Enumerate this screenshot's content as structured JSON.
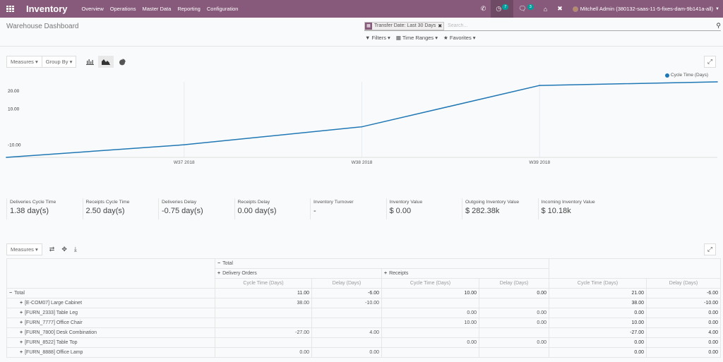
{
  "navbar": {
    "app_name": "Inventory",
    "menu": [
      "Overview",
      "Operations",
      "Master Data",
      "Reporting",
      "Configuration"
    ],
    "activity_count": "7",
    "message_count": "3",
    "user": "Mitchell Admin (380132-saas-11-5-fixes-dam-9b141a-all)",
    "accent": "#875a7b"
  },
  "control_panel": {
    "title": "Warehouse Dashboard",
    "facet": "Transfer Date: Last 30 Days",
    "search_placeholder": "Search...",
    "filters": "Filters",
    "time_ranges": "Time Ranges",
    "favorites": "Favorites"
  },
  "graph_toolbar": {
    "measures": "Measures",
    "group_by": "Group By"
  },
  "chart_data": {
    "type": "line",
    "x": [
      "",
      "W37 2018",
      "W38 2018",
      "W39 2018",
      ""
    ],
    "xticks": [
      "W37 2018",
      "W38 2018",
      "W39 2018"
    ],
    "series": [
      {
        "name": "Cycle Time (Days)",
        "values": [
          -17,
          -10,
          0,
          23,
          25
        ],
        "color": "#1f77b4"
      }
    ],
    "yticks": [
      "20.00",
      "10.00",
      "-10.00"
    ],
    "ytick_values": [
      20,
      10,
      -10
    ],
    "ylim": [
      -17,
      25
    ],
    "legend": "top-right",
    "grid": true
  },
  "kpis": [
    {
      "label": "Deliveries Cycle Time",
      "value": "1.38 day(s)"
    },
    {
      "label": "Receipts Cycle Time",
      "value": "2.50 day(s)"
    },
    {
      "label": "Deliveries Delay",
      "value": "-0.75 day(s)"
    },
    {
      "label": "Receipts Delay",
      "value": "0.00 day(s)"
    },
    {
      "label": "Inventory Turnover",
      "value": "-"
    },
    {
      "label": "Inventory Value",
      "value": "$ 0.00"
    },
    {
      "label": "Outgoing Inventory Value",
      "value": "$ 282.38k"
    },
    {
      "label": "Incoming Inventory Value",
      "value": "$ 10.18k"
    }
  ],
  "pivot": {
    "measures": "Measures",
    "col_total": "Total",
    "col_groups": [
      "Delivery Orders",
      "Receipts"
    ],
    "measure_headers": [
      "Cycle Time (Days)",
      "Delay (Days)",
      "Cycle Time (Days)",
      "Delay (Days)",
      "Cycle Time (Days)",
      "Delay (Days)"
    ],
    "rows": [
      {
        "label": "Total",
        "cells": [
          "11.00",
          "-6.00",
          "10.00",
          "0.00",
          "21.00",
          "-6.00"
        ]
      },
      {
        "label": "[E-COM07] Large Cabinet",
        "cells": [
          "38.00",
          "-10.00",
          "",
          "",
          "38.00",
          "-10.00"
        ]
      },
      {
        "label": "[FURN_2333] Table Leg",
        "cells": [
          "",
          "",
          "0.00",
          "0.00",
          "0.00",
          "0.00"
        ]
      },
      {
        "label": "[FURN_7777] Office Chair",
        "cells": [
          "",
          "",
          "10.00",
          "0.00",
          "10.00",
          "0.00"
        ]
      },
      {
        "label": "[FURN_7800] Desk Combination",
        "cells": [
          "-27.00",
          "4.00",
          "",
          "",
          "-27.00",
          "4.00"
        ]
      },
      {
        "label": "[FURN_8522] Table Top",
        "cells": [
          "",
          "",
          "0.00",
          "0.00",
          "0.00",
          "0.00"
        ]
      },
      {
        "label": "[FURN_8888] Office Lamp",
        "cells": [
          "0.00",
          "0.00",
          "",
          "",
          "0.00",
          "0.00"
        ]
      }
    ]
  }
}
